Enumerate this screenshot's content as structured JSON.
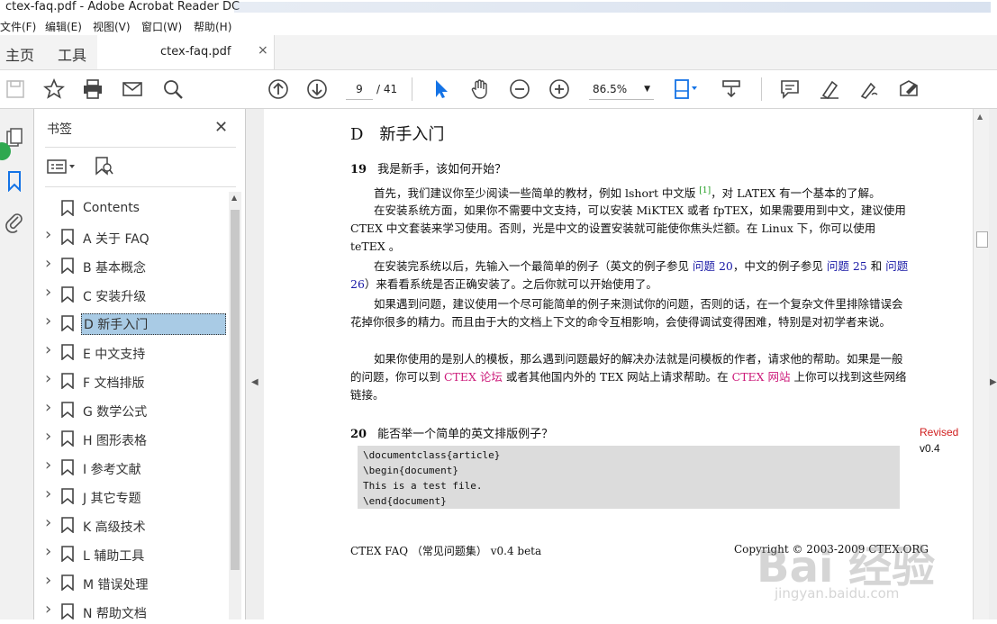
{
  "window": {
    "title": "ctex-faq.pdf - Adobe Acrobat Reader DC"
  },
  "menu": [
    "文件(F)",
    "编辑(E)",
    "视图(V)",
    "窗口(W)",
    "帮助(H)"
  ],
  "tabs": {
    "home": "主页",
    "tools": "工具",
    "document": "ctex-faq.pdf",
    "close": "×"
  },
  "toolbar": {
    "page_current": "9",
    "page_total": "/ 41",
    "zoom": "86.5%",
    "icons": [
      "save-icon",
      "star-icon",
      "print-icon",
      "email-icon",
      "search-icon",
      "page-up-icon",
      "page-down-icon",
      "zoom-out-icon",
      "zoom-in-icon",
      "pointer-icon",
      "hand-icon",
      "fit-page-icon",
      "scroll-mode-icon",
      "comment-icon",
      "highlight-icon",
      "sign-icon",
      "fill-sign-icon"
    ]
  },
  "colors": {
    "accent": "#1473e6",
    "selected_bookmark": "#a9cbe5",
    "link": "#1a1aa6",
    "ctex_link": "#cc1a7a",
    "revised": "#d01e1e"
  },
  "bookmarks_panel": {
    "title": "书签",
    "close": "✕",
    "items": [
      {
        "label": "Contents",
        "expandable": false,
        "selected": false
      },
      {
        "label": "A 关于 FAQ",
        "expandable": true,
        "selected": false
      },
      {
        "label": "B 基本概念",
        "expandable": true,
        "selected": false
      },
      {
        "label": "C 安装升级",
        "expandable": true,
        "selected": false
      },
      {
        "label": "D 新手入门",
        "expandable": true,
        "selected": true
      },
      {
        "label": "E 中文支持",
        "expandable": true,
        "selected": false
      },
      {
        "label": "F 文档排版",
        "expandable": true,
        "selected": false
      },
      {
        "label": "G 数学公式",
        "expandable": true,
        "selected": false
      },
      {
        "label": "H 图形表格",
        "expandable": true,
        "selected": false
      },
      {
        "label": "I 参考文献",
        "expandable": true,
        "selected": false
      },
      {
        "label": "J 其它专题",
        "expandable": true,
        "selected": false
      },
      {
        "label": "K 高级技术",
        "expandable": true,
        "selected": false
      },
      {
        "label": "L 辅助工具",
        "expandable": true,
        "selected": false
      },
      {
        "label": "M 错误处理",
        "expandable": true,
        "selected": false
      },
      {
        "label": "N 帮助文档",
        "expandable": true,
        "selected": false
      }
    ]
  },
  "page": {
    "section": "D　新手入门",
    "q19": {
      "num": "19",
      "title": "我是新手，该如何开始？"
    },
    "p1": {
      "a": "首先，我们建议你至少阅读一些简单的教材，例如 lshort 中文版 ",
      "ref": "[1]",
      "b": "，对 LATEX 有一个基本的了解。"
    },
    "p2": "在安装系统方面，如果你不需要中文支持，可以安装 MiKTEX 或者 fpTEX，如果需要用到中文，建议使用 CTEX 中文套装来学习使用。否则，光是中文的设置安装就可能使你焦头烂额。在 Linux 下，你可以使用 teTEX 。",
    "p3": {
      "a": "在安装完系统以后，先输入一个最简单的例子（英文的例子参见 ",
      "l1": "问题 20",
      "b": "，中文的例子参见 ",
      "l2": "问题 25",
      "c": " 和 ",
      "l3": "问题 26",
      "d": "）来看看系统是否正确安装了。之后你就可以开始使用了。"
    },
    "p4": "如果遇到问题，建议使用一个尽可能简单的例子来测试你的问题，否则的话，在一个复杂文件里排除错误会花掉你很多的精力。而且由于大的文档上下文的命令互相影响，会使得调试变得困难，特别是对初学者来说。",
    "p5": {
      "a": "如果你使用的是别人的模板，那么遇到问题最好的解决办法就是问模板的作者，请求他的帮助。如果是一般的问题，你可以到 ",
      "l1": "CTEX 论坛",
      "b": " 或者其他国内外的 TEX 网站上请求帮助。在 ",
      "l2": "CTEX 网站",
      "c": " 上你可以找到这些网络链接。"
    },
    "q20": {
      "num": "20",
      "title": "能否举一个简单的英文排版例子？"
    },
    "code": [
      "\\documentclass{article}",
      "\\begin{document}",
      "This is a test file.",
      "\\end{document}"
    ],
    "revised": "Revised",
    "version": "v0.4",
    "footer_left": "CTEX FAQ （常见问题集） v0.4 beta",
    "footer_right": "Copyright © 2003-2009 CTEX.ORG"
  },
  "watermark": {
    "main": "Bai 经验",
    "sub": "jingyan.baidu.com"
  }
}
